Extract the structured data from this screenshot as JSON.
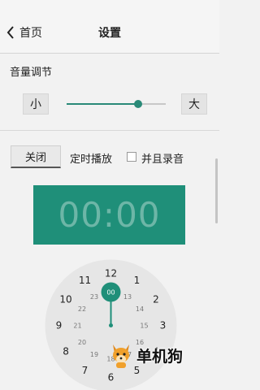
{
  "header": {
    "back_label": "首页",
    "title": "设置"
  },
  "volume": {
    "label": "音量调节",
    "min_label": "小",
    "max_label": "大",
    "level": 0.72
  },
  "timer": {
    "close_label": "关闭",
    "timer_label": "定时播放",
    "record_checked": false,
    "record_label": "并且录音",
    "display_time": "00:00"
  },
  "clock": {
    "selected_label": "00",
    "outer_hours": [
      "12",
      "1",
      "2",
      "3",
      "4",
      "5",
      "6",
      "7",
      "8",
      "9",
      "10",
      "11"
    ],
    "inner_hours": [
      "00",
      "13",
      "14",
      "15",
      "16",
      "17",
      "18",
      "19",
      "20",
      "21",
      "22",
      "23"
    ],
    "selected_hour_index": 0
  },
  "colors": {
    "accent": "#1f8f79",
    "slider": "#2a8a78"
  },
  "watermark": {
    "text": "单机狗"
  }
}
